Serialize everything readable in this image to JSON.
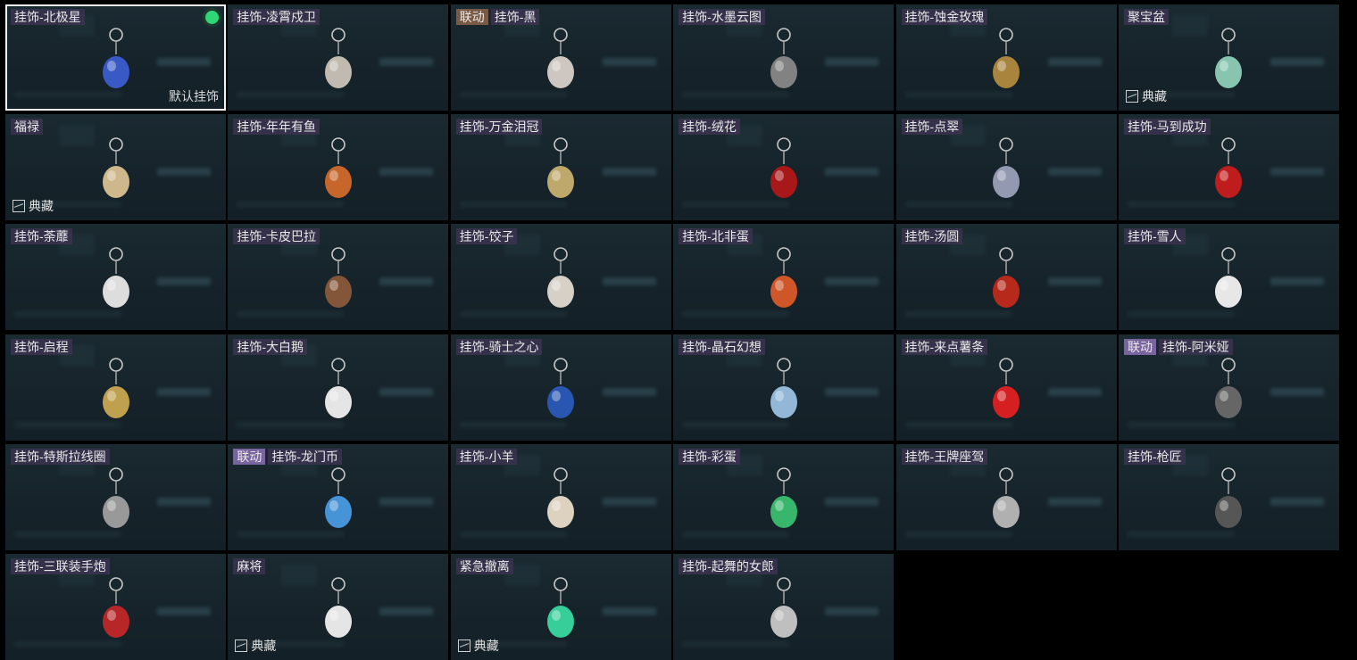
{
  "default_label": "默认挂饰",
  "collection_label": "典藏",
  "items": [
    {
      "name": "挂饰-北极星",
      "collab": "",
      "selected": true,
      "collection": false,
      "icon": "polaris-charm-icon",
      "color": "#3b5ecf"
    },
    {
      "name": "挂饰-凌霄戍卫",
      "collab": "",
      "selected": false,
      "collection": false,
      "icon": "rocket-charm-icon",
      "color": "#c9c3b8"
    },
    {
      "name": "挂饰-黑",
      "collab": "联动",
      "collabStyle": "brown",
      "selected": false,
      "collection": false,
      "icon": "black-tag-charm-icon",
      "color": "#d8d0c8"
    },
    {
      "name": "挂饰-水墨云图",
      "collab": "",
      "selected": false,
      "collection": false,
      "icon": "ink-ball-charm-icon",
      "color": "#888888"
    },
    {
      "name": "挂饰-蚀金玫瑰",
      "collab": "",
      "selected": false,
      "collection": false,
      "icon": "gold-rose-charm-icon",
      "color": "#b08a3e"
    },
    {
      "name": "聚宝盆",
      "collab": "",
      "selected": false,
      "collection": true,
      "icon": "treasure-bowl-charm-icon",
      "color": "#8ecfb8"
    },
    {
      "name": "福禄",
      "collab": "",
      "selected": false,
      "collection": true,
      "icon": "gourd-charm-icon",
      "color": "#d8c090"
    },
    {
      "name": "挂饰-年年有鱼",
      "collab": "",
      "selected": false,
      "collection": false,
      "icon": "fish-charm-icon",
      "color": "#d06a2a"
    },
    {
      "name": "挂饰-万金泪冠",
      "collab": "",
      "selected": false,
      "collection": false,
      "icon": "crown-charm-icon",
      "color": "#c8b070"
    },
    {
      "name": "挂饰-绒花",
      "collab": "",
      "selected": false,
      "collection": false,
      "icon": "velvet-flower-charm-icon",
      "color": "#b01818"
    },
    {
      "name": "挂饰-点翠",
      "collab": "",
      "selected": false,
      "collection": false,
      "icon": "kingfisher-charm-icon",
      "color": "#9aa0b8"
    },
    {
      "name": "挂饰-马到成功",
      "collab": "",
      "selected": false,
      "collection": false,
      "icon": "horse-charm-icon",
      "color": "#c81c1c"
    },
    {
      "name": "挂饰-荼蘼",
      "collab": "",
      "selected": false,
      "collection": false,
      "icon": "white-flower-charm-icon",
      "color": "#e8e8e8"
    },
    {
      "name": "挂饰-卡皮巴拉",
      "collab": "",
      "selected": false,
      "collection": false,
      "icon": "capybara-charm-icon",
      "color": "#8a5a3a"
    },
    {
      "name": "挂饰-饺子",
      "collab": "",
      "selected": false,
      "collection": false,
      "icon": "dumpling-plate-charm-icon",
      "color": "#e0dad0"
    },
    {
      "name": "挂饰-北非蛋",
      "collab": "",
      "selected": false,
      "collection": false,
      "icon": "shakshuka-charm-icon",
      "color": "#d85a28"
    },
    {
      "name": "挂饰-汤圆",
      "collab": "",
      "selected": false,
      "collection": false,
      "icon": "tangyuan-bowl-charm-icon",
      "color": "#c02a1a"
    },
    {
      "name": "挂饰-雪人",
      "collab": "",
      "selected": false,
      "collection": false,
      "icon": "snowman-charm-icon",
      "color": "#f2f2f2"
    },
    {
      "name": "挂饰-启程",
      "collab": "",
      "selected": false,
      "collection": false,
      "icon": "compass-medal-charm-icon",
      "color": "#c8a850"
    },
    {
      "name": "挂饰-大白鹅",
      "collab": "",
      "selected": false,
      "collection": false,
      "icon": "goose-charm-icon",
      "color": "#f0f0f0"
    },
    {
      "name": "挂饰-骑士之心",
      "collab": "",
      "selected": false,
      "collection": false,
      "icon": "knight-heart-charm-icon",
      "color": "#2a5ab8"
    },
    {
      "name": "挂饰-晶石幻想",
      "collab": "",
      "selected": false,
      "collection": false,
      "icon": "crystal-cube-charm-icon",
      "color": "#9ac0e0"
    },
    {
      "name": "挂饰-来点薯条",
      "collab": "",
      "selected": false,
      "collection": false,
      "icon": "fries-charm-icon",
      "color": "#e02020"
    },
    {
      "name": "挂饰-阿米娅",
      "collab": "联动",
      "collabStyle": "purple",
      "selected": false,
      "collection": false,
      "icon": "amiya-charm-icon",
      "color": "#6a6a6a"
    },
    {
      "name": "挂饰-特斯拉线圈",
      "collab": "",
      "selected": false,
      "collection": false,
      "icon": "tesla-coil-charm-icon",
      "color": "#a0a0a0"
    },
    {
      "name": "挂饰-龙门币",
      "collab": "联动",
      "collabStyle": "purple",
      "selected": false,
      "collection": false,
      "icon": "lungmen-coin-charm-icon",
      "color": "#4a9ae0"
    },
    {
      "name": "挂饰-小羊",
      "collab": "",
      "selected": false,
      "collection": false,
      "icon": "lamb-charm-icon",
      "color": "#e8dcc8"
    },
    {
      "name": "挂饰-彩蛋",
      "collab": "",
      "selected": false,
      "collection": false,
      "icon": "easter-egg-charm-icon",
      "color": "#3ac070"
    },
    {
      "name": "挂饰-王牌座驾",
      "collab": "",
      "selected": false,
      "collection": false,
      "icon": "jet-plane-charm-icon",
      "color": "#b8b8b8"
    },
    {
      "name": "挂饰-枪匠",
      "collab": "",
      "selected": false,
      "collection": false,
      "icon": "gunsmith-box-charm-icon",
      "color": "#5a5a5a"
    },
    {
      "name": "挂饰-三联装手炮",
      "collab": "",
      "selected": false,
      "collection": false,
      "icon": "hand-cannon-charm-icon",
      "color": "#c02828"
    },
    {
      "name": "麻将",
      "collab": "",
      "selected": false,
      "collection": true,
      "icon": "mahjong-tile-charm-icon",
      "color": "#f0f0f0"
    },
    {
      "name": "紧急撤离",
      "collab": "",
      "selected": false,
      "collection": true,
      "icon": "emergency-exit-charm-icon",
      "color": "#3ad8a0"
    },
    {
      "name": "挂饰-起舞的女郎",
      "collab": "",
      "selected": false,
      "collection": false,
      "icon": "dancing-lady-charm-icon",
      "color": "#c8c8c8"
    }
  ]
}
